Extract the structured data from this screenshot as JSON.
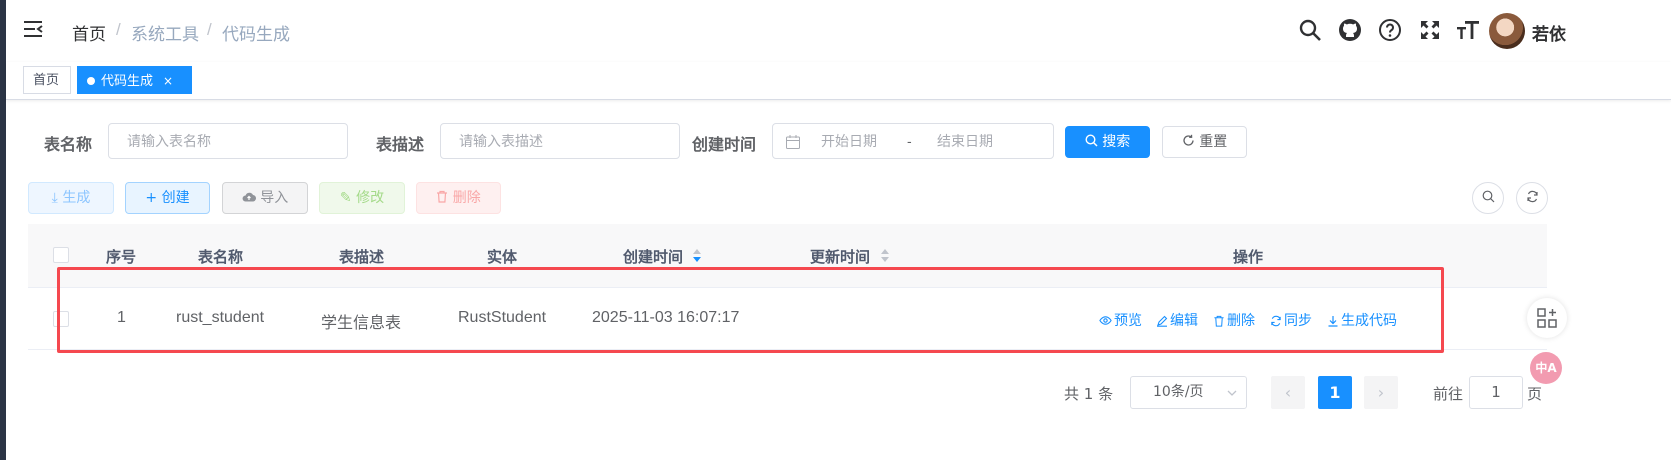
{
  "header": {
    "breadcrumb": [
      "首页",
      "系统工具",
      "代码生成"
    ],
    "breadcrumb_sep": "/",
    "username": "若依"
  },
  "tags": [
    {
      "label": "首页",
      "active": false
    },
    {
      "label": "代码生成",
      "active": true,
      "close": "×"
    }
  ],
  "search": {
    "table_name_label": "表名称",
    "table_name_placeholder": "请输入表名称",
    "table_desc_label": "表描述",
    "table_desc_placeholder": "请输入表描述",
    "create_time_label": "创建时间",
    "start_placeholder": "开始日期",
    "range_sep": "-",
    "end_placeholder": "结束日期",
    "search_btn": "搜索",
    "reset_btn": "重置"
  },
  "toolbar": {
    "generate": "生成",
    "create": "创建",
    "import": "导入",
    "edit": "修改",
    "delete": "删除"
  },
  "table": {
    "columns": [
      "序号",
      "表名称",
      "表描述",
      "实体",
      "创建时间",
      "更新时间",
      "操作"
    ],
    "rows": [
      {
        "index": "1",
        "table_name": "rust_student",
        "table_desc": "学生信息表",
        "entity": "RustStudent",
        "create_time": "2025-11-03 16:07:17",
        "update_time": "",
        "ops": [
          "预览",
          "编辑",
          "删除",
          "同步",
          "生成代码"
        ]
      }
    ]
  },
  "pagination": {
    "total_text": "共 1 条",
    "page_size": "10条/页",
    "prev": "‹",
    "current_page": "1",
    "next": "›",
    "goto_label": "前往",
    "goto_value": "1",
    "page_unit": "页"
  },
  "float": {
    "translate": "中A"
  },
  "colors": {
    "primary": "#1890ff",
    "highlight": "#f5484f"
  }
}
